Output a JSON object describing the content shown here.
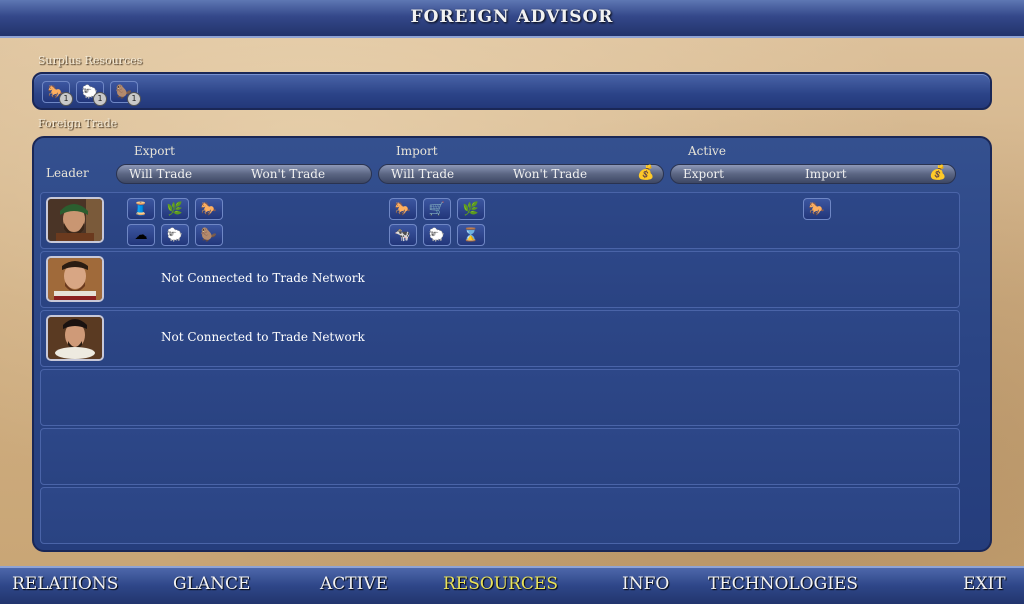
{
  "window": {
    "title": "FOREIGN ADVISOR"
  },
  "surplus": {
    "label": "Surplus Resources",
    "items": [
      {
        "icon": "horse-icon",
        "glyph": "🐎",
        "count": "1"
      },
      {
        "icon": "sheep-icon",
        "glyph": "🐑",
        "count": "1"
      },
      {
        "icon": "fur-icon",
        "glyph": "🦫",
        "count": "1"
      }
    ]
  },
  "trade": {
    "label": "Foreign Trade",
    "leader_header": "Leader",
    "export": {
      "header": "Export",
      "will": "Will Trade",
      "wont": "Won't Trade"
    },
    "import": {
      "header": "Import",
      "will": "Will Trade",
      "wont": "Won't Trade"
    },
    "active": {
      "header": "Active",
      "export": "Export",
      "import": "Import"
    },
    "rows": [
      {
        "leader": "leader-1",
        "export_icons": [
          {
            "icon": "silk-icon",
            "glyph": "🧵"
          },
          {
            "icon": "spice-icon",
            "glyph": "🌿"
          },
          {
            "icon": "horse-icon",
            "glyph": "🐎"
          },
          {
            "icon": "cotton-icon",
            "glyph": "☁"
          },
          {
            "icon": "sheep-icon",
            "glyph": "🐑"
          },
          {
            "icon": "fur-icon",
            "glyph": "🦫"
          }
        ],
        "import_icons": [
          {
            "icon": "horse-icon",
            "glyph": "🐎"
          },
          {
            "icon": "wagon-icon",
            "glyph": "🛒"
          },
          {
            "icon": "spice-icon",
            "glyph": "🌿"
          },
          {
            "icon": "cow-icon",
            "glyph": "🐄"
          },
          {
            "icon": "sheep-icon",
            "glyph": "🐑"
          },
          {
            "icon": "wheat-icon",
            "glyph": "⌛"
          }
        ],
        "active_import_icons": [
          {
            "icon": "horse-icon",
            "glyph": "🐎"
          }
        ],
        "message": ""
      },
      {
        "leader": "leader-2",
        "message": "Not Connected to Trade Network"
      },
      {
        "leader": "leader-3",
        "message": "Not Connected to Trade Network"
      }
    ]
  },
  "nav": {
    "items": [
      {
        "label": "RELATIONS",
        "active": false
      },
      {
        "label": "GLANCE",
        "active": false
      },
      {
        "label": "ACTIVE",
        "active": false
      },
      {
        "label": "RESOURCES",
        "active": true
      },
      {
        "label": "INFO",
        "active": false
      },
      {
        "label": "TECHNOLOGIES",
        "active": false
      },
      {
        "label": "EXIT",
        "active": false
      }
    ]
  },
  "colors": {
    "panel_blue": "#2b4585",
    "parchment": "#cfae82",
    "active_nav": "#e9e25a",
    "gold_icon": "#f1d81c"
  }
}
